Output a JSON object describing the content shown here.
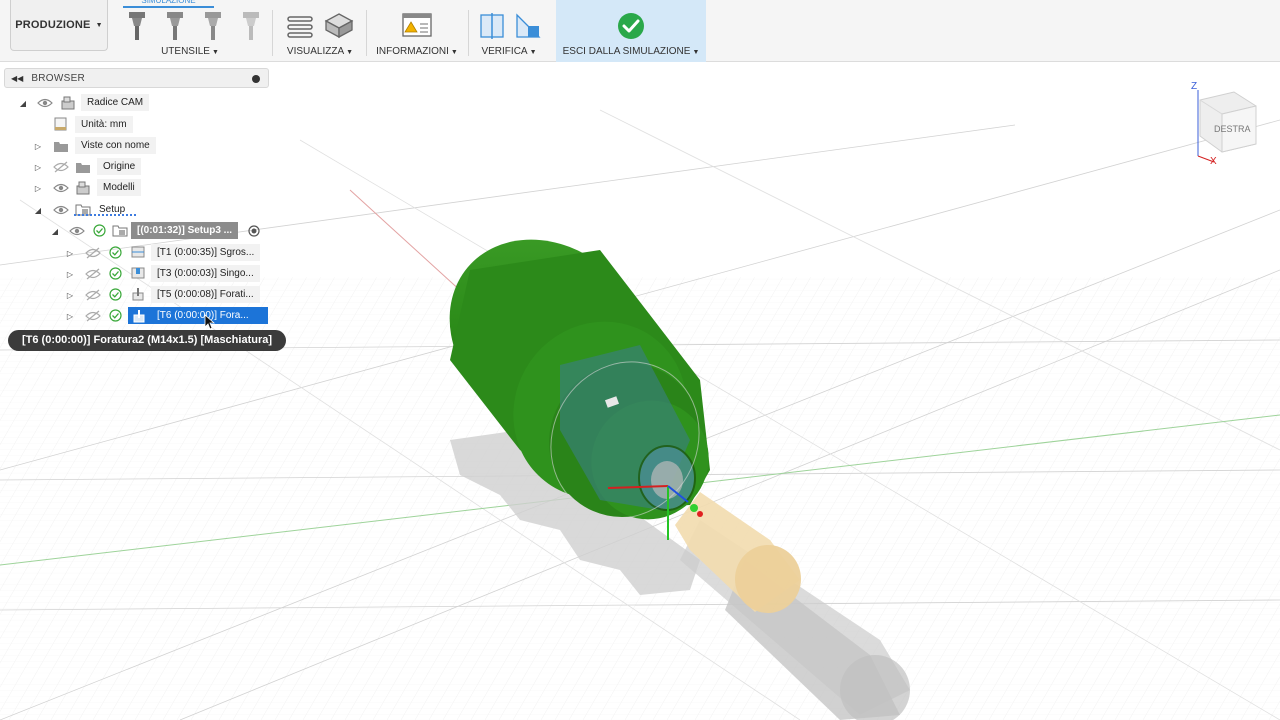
{
  "toolbar": {
    "workspace": "PRODUZIONE",
    "active_tab": "SIMULAZIONE",
    "groups": {
      "utensile": "UTENSILE",
      "visualizza": "VISUALIZZA",
      "informazioni": "INFORMAZIONI",
      "verifica": "VERIFICA",
      "esci": "ESCI DALLA SIMULAZIONE"
    }
  },
  "browser": {
    "title": "BROWSER",
    "items": {
      "root": "Radice CAM",
      "units": "Unità: mm",
      "named_views": "Viste con nome",
      "origin": "Origine",
      "models": "Modelli",
      "setup": "Setup",
      "setup3": "[(0:01:32)] Setup3 ...",
      "op_t1": "[T1 (0:00:35)] Sgros...",
      "op_t3": "[T3 (0:00:03)] Singo...",
      "op_t5": "[T5 (0:00:08)] Forati...",
      "op_t6": "[T6 (0:00:00)] Fora..."
    },
    "tooltip": "[T6 (0:00:00)] Foratura2 (M14x1.5) [Maschiatura]"
  },
  "viewcube": {
    "face": "DESTRA",
    "axis_z": "Z",
    "axis_x": "X"
  },
  "colors": {
    "accent": "#1c74d8",
    "part": "#2e8b1e",
    "stock": "#f0d9a8",
    "check": "#2aa84a"
  }
}
